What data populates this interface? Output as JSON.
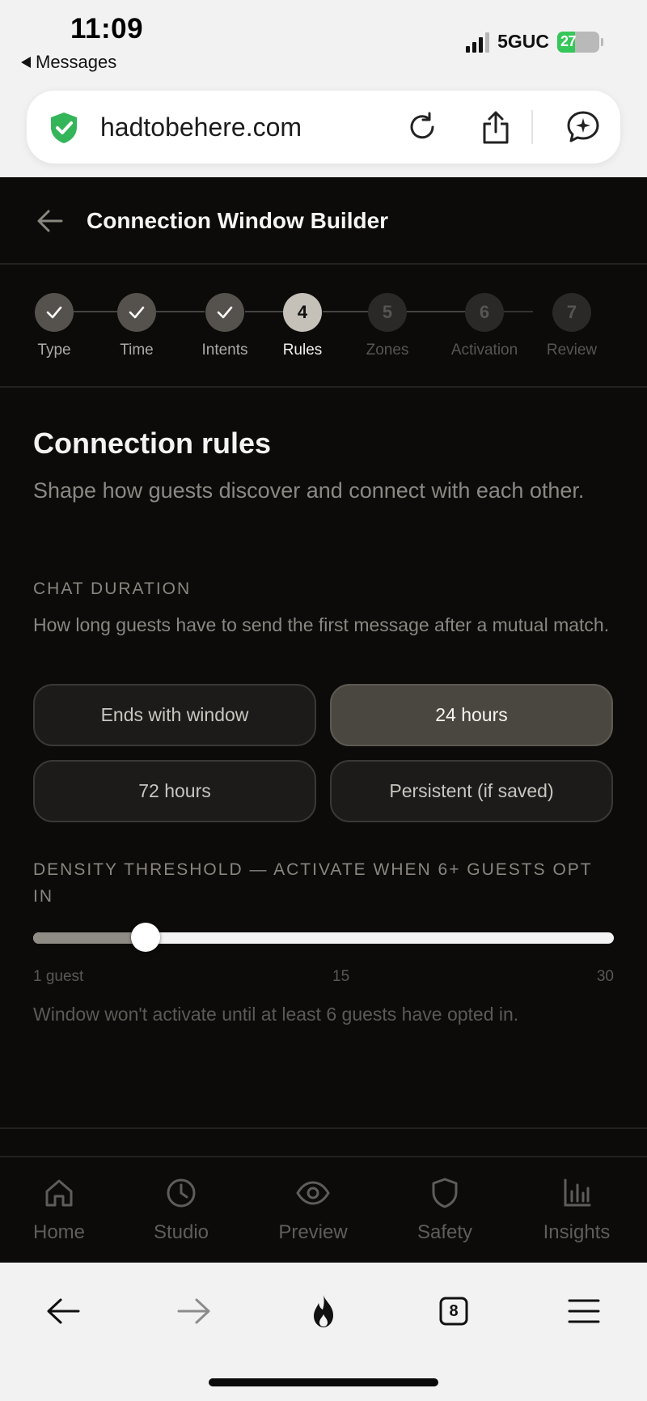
{
  "status_bar": {
    "time": "11:09",
    "back_app": "Messages",
    "network": "5GUC",
    "battery": "27"
  },
  "browser": {
    "url": "hadtobehere.com"
  },
  "header": {
    "title": "Connection Window Builder"
  },
  "stepper": {
    "steps": [
      {
        "number": "1",
        "label": "Type",
        "state": "done"
      },
      {
        "number": "2",
        "label": "Time",
        "state": "done"
      },
      {
        "number": "3",
        "label": "Intents",
        "state": "done"
      },
      {
        "number": "4",
        "label": "Rules",
        "state": "current"
      },
      {
        "number": "5",
        "label": "Zones",
        "state": "todo"
      },
      {
        "number": "6",
        "label": "Activation",
        "state": "todo"
      },
      {
        "number": "7",
        "label": "Review",
        "state": "todo"
      }
    ]
  },
  "section": {
    "title": "Connection rules",
    "subtitle": "Shape how guests discover and connect with each other."
  },
  "chat_duration": {
    "label": "CHAT DURATION",
    "help": "How long guests have to send the first message after a mutual match.",
    "options": [
      {
        "label": "Ends with window",
        "selected": false
      },
      {
        "label": "24 hours",
        "selected": true
      },
      {
        "label": "72 hours",
        "selected": false
      },
      {
        "label": "Persistent (if saved)",
        "selected": false
      }
    ]
  },
  "density": {
    "label": "DENSITY THRESHOLD — ACTIVATE WHEN 6+ GUESTS OPT IN",
    "min": 1,
    "max": 30,
    "value": 6,
    "tick_min": "1 guest",
    "tick_mid": "15",
    "tick_max": "30",
    "note": "Window won't activate until at least 6 guests have opted in."
  },
  "tabbar": {
    "items": [
      {
        "label": "Home",
        "icon": "home-icon"
      },
      {
        "label": "Studio",
        "icon": "clock-icon"
      },
      {
        "label": "Preview",
        "icon": "eye-icon"
      },
      {
        "label": "Safety",
        "icon": "shield-icon"
      },
      {
        "label": "Insights",
        "icon": "bar-chart-icon"
      }
    ]
  },
  "safari": {
    "tab_count": "8"
  },
  "colors": {
    "accent_selected": "#4a4741",
    "background": "#0c0b0a",
    "success_green": "#35c759"
  }
}
